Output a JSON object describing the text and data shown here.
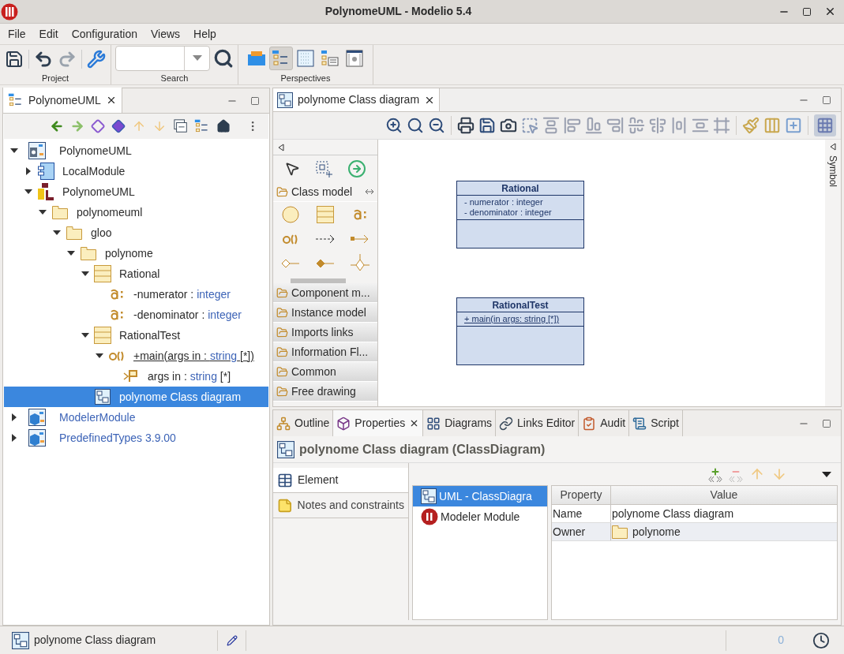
{
  "window": {
    "title": "PolynomeUML - Modelio 5.4"
  },
  "menu": [
    "File",
    "Edit",
    "Configuration",
    "Views",
    "Help"
  ],
  "toolbar": {
    "groups": [
      "Project",
      "Search",
      "Perspectives"
    ],
    "perspectives": [
      {
        "selected": false
      },
      {
        "selected": true
      },
      {
        "selected": false
      },
      {
        "selected": false
      },
      {
        "selected": false
      }
    ]
  },
  "explorer": {
    "tab": "PolynomeUML",
    "tree": [
      {
        "kind": "project",
        "label": "PolynomeUML",
        "expanded": true,
        "selected": false,
        "children": [
          {
            "kind": "component",
            "label": "LocalModule",
            "expanded": false,
            "selected": false
          },
          {
            "kind": "uml",
            "label": "PolynomeUML",
            "expanded": true,
            "selected": false,
            "children": [
              {
                "kind": "package",
                "label": "polynomeuml",
                "expanded": true,
                "selected": false,
                "children": [
                  {
                    "kind": "package",
                    "label": "gloo",
                    "expanded": true,
                    "selected": false,
                    "children": [
                      {
                        "kind": "package",
                        "label": "polynome",
                        "expanded": true,
                        "selected": false,
                        "children": [
                          {
                            "kind": "class",
                            "label": "Rational",
                            "expanded": true,
                            "selected": false,
                            "children": [
                              {
                                "kind": "attribute",
                                "label": "-numerator : ",
                                "type": "integer",
                                "selected": false
                              },
                              {
                                "kind": "attribute",
                                "label": "-denominator : ",
                                "type": "integer",
                                "selected": false
                              }
                            ]
                          },
                          {
                            "kind": "class",
                            "label": "RationalTest",
                            "expanded": true,
                            "selected": false,
                            "children": [
                              {
                                "kind": "operation",
                                "label": "+main(args in : ",
                                "type": "string",
                                "suffix": " [*])",
                                "expanded": true,
                                "selected": false,
                                "children": [
                                  {
                                    "kind": "parameter",
                                    "label": "args in : ",
                                    "type": "string",
                                    "suffix": " [*]",
                                    "selected": false
                                  }
                                ]
                              }
                            ]
                          },
                          {
                            "kind": "diagram",
                            "label": "polynome Class diagram",
                            "selected": true
                          }
                        ]
                      }
                    ]
                  }
                ]
              }
            ]
          }
        ]
      },
      {
        "kind": "module",
        "label": "ModelerModule",
        "expanded": false,
        "selected": false
      },
      {
        "kind": "module",
        "label": "PredefinedTypes 3.9.00",
        "expanded": false,
        "selected": false
      }
    ]
  },
  "editor": {
    "tab": "polynome Class diagram",
    "grid": {
      "selected": true
    },
    "palette": {
      "groups": [
        {
          "label": "Class model",
          "expanded": true
        },
        {
          "label": "Component m...",
          "expanded": false
        },
        {
          "label": "Instance model",
          "expanded": false
        },
        {
          "label": "Imports links",
          "expanded": false
        },
        {
          "label": "Information Fl...",
          "expanded": false
        },
        {
          "label": "Common",
          "expanded": false
        },
        {
          "label": "Free drawing",
          "expanded": false
        }
      ]
    },
    "classes": [
      {
        "name": "Rational",
        "attributes": [
          "- numerator : integer",
          "- denominator : integer"
        ]
      },
      {
        "name": "RationalTest",
        "operations": [
          "+ main(in args: string [*])"
        ]
      }
    ],
    "side_tab": "Symbol"
  },
  "properties": {
    "tabs": [
      {
        "kind": "outline",
        "label": "Outline",
        "selected": false
      },
      {
        "kind": "properties",
        "label": "Properties",
        "selected": true
      },
      {
        "kind": "diagrams",
        "label": "Diagrams",
        "selected": false
      },
      {
        "kind": "links",
        "label": "Links Editor",
        "selected": false
      },
      {
        "kind": "audit",
        "label": "Audit",
        "selected": false
      },
      {
        "kind": "script",
        "label": "Script",
        "selected": false
      }
    ],
    "header": "polynome Class diagram (ClassDiagram)",
    "sections": [
      {
        "kind": "element",
        "label": "Element",
        "selected": true
      },
      {
        "kind": "notes",
        "label": "Notes and constraints",
        "selected": false
      }
    ],
    "facets": [
      {
        "kind": "uml",
        "label": "UML - ClassDiagra",
        "selected": true
      },
      {
        "kind": "modeler",
        "label": "Modeler Module",
        "selected": false
      }
    ],
    "table": {
      "columns": [
        "Property",
        "Value"
      ],
      "rows": [
        {
          "property": "Name",
          "value": "polynome Class diagram"
        },
        {
          "property": "Owner",
          "value": "polynome",
          "kind": "package"
        }
      ]
    }
  },
  "status_bar": {
    "selection": "polynome Class diagram",
    "count": "0"
  }
}
